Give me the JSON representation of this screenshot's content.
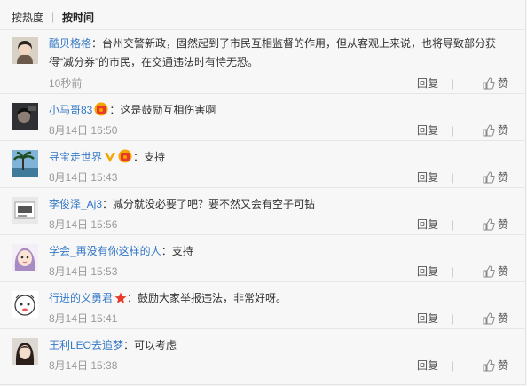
{
  "sort": {
    "hot": "按热度",
    "separator": "|",
    "time": "按时间"
  },
  "comments": [
    {
      "user": "酷贝格格",
      "text": "：台州交警新政，固然起到了市民互相监督的作用，但从客观上来说，也将导致部分获得“减分券”的市民，在交通违法时有恃无恐。",
      "time": "10秒前",
      "badge": "",
      "avatar_icon": "woman-avatar-icon"
    },
    {
      "user": "小马哥83",
      "text": "：这是鼓励互相伤害啊",
      "time": "8月14日 16:50",
      "badge": "red-envelope-badge-icon",
      "avatar_icon": "man-avatar-icon"
    },
    {
      "user": "寻宝走世界",
      "text": "：支持",
      "time": "8月14日 15:43",
      "badge": "verified-v-icon,red-envelope-badge-icon",
      "avatar_icon": "palm-tree-avatar-icon"
    },
    {
      "user": "李俊泽_Aj3",
      "text": "：减分就没必要了吧？要不然又会有空子可钻",
      "time": "8月14日 15:56",
      "badge": "",
      "avatar_icon": "default-avatar-icon"
    },
    {
      "user": "学会_再没有你这样的人",
      "text": "：支持",
      "time": "8月14日 15:53",
      "badge": "",
      "avatar_icon": "cartoon-girl-avatar-icon"
    },
    {
      "user": "行进的义勇君",
      "text": "：鼓励大家举报违法，非常好呀。",
      "time": "8月14日 15:41",
      "badge": "star-badge-icon",
      "avatar_icon": "cartoon-face-avatar-icon"
    },
    {
      "user": "王利LEO去追梦",
      "text": "：可以考虑",
      "time": "8月14日 15:38",
      "badge": "",
      "avatar_icon": "girl-avatar-icon"
    }
  ],
  "actions": {
    "reply": "回复",
    "like": "赞",
    "like_icon": "thumbs-up-icon"
  },
  "colors": {
    "username": "#3478c5",
    "time": "#999999",
    "badge_red": "#e83a2a",
    "badge_gold": "#f5a400"
  }
}
